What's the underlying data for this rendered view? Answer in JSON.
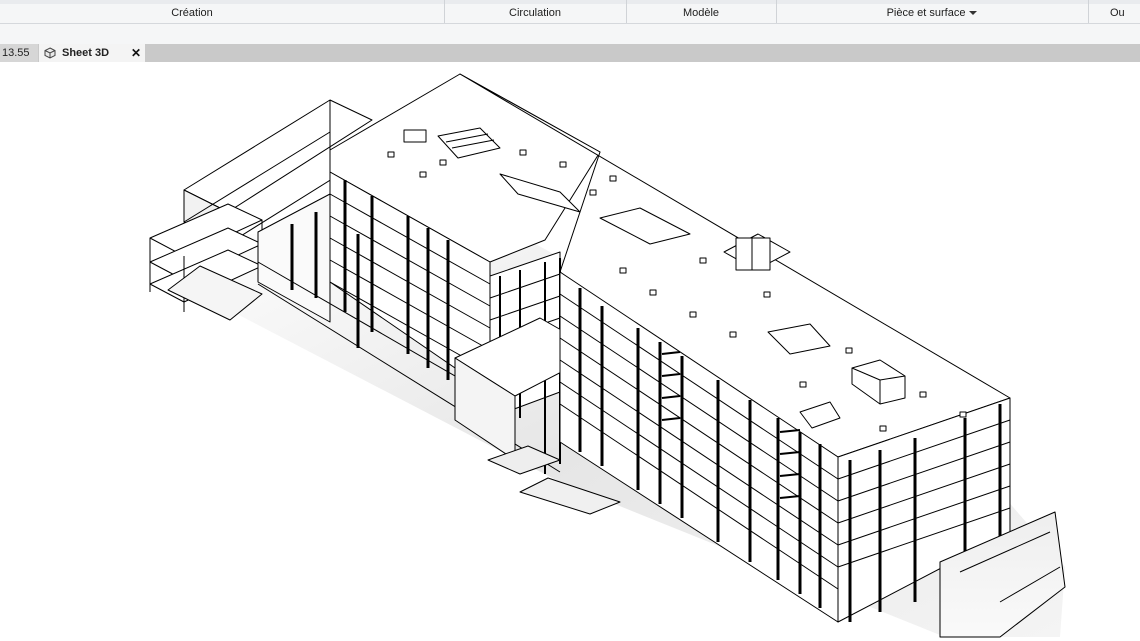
{
  "ribbon": {
    "panels": [
      {
        "title": "Création"
      },
      {
        "title": "Circulation"
      },
      {
        "title": "Modèle"
      },
      {
        "title": "Pièce et surface",
        "has_dropdown": true
      },
      {
        "title": "Ou"
      }
    ]
  },
  "tabs": {
    "inactive_label": "13.55",
    "active_label": "Sheet 3D",
    "close_glyph": "✕"
  },
  "viewport": {
    "content": "3d-structural-model",
    "icons": {
      "tab": "3d-view-icon",
      "close": "close-icon"
    }
  }
}
